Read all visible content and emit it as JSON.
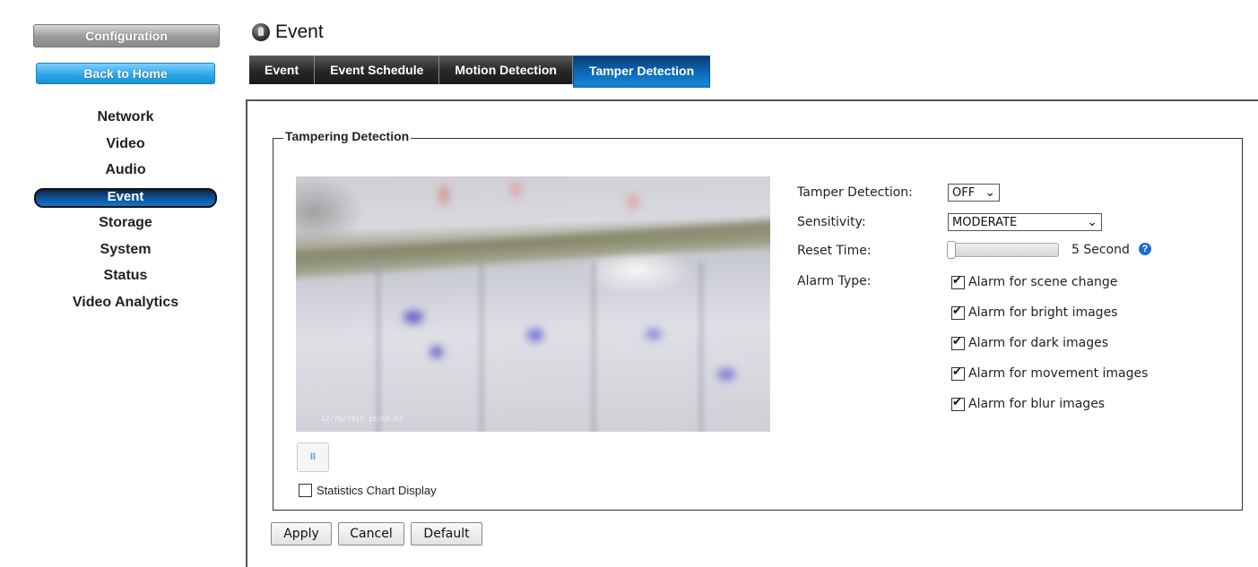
{
  "sidebar": {
    "config_label": "Configuration",
    "home_label": "Back to Home",
    "items": [
      {
        "label": "Network"
      },
      {
        "label": "Video"
      },
      {
        "label": "Audio"
      },
      {
        "label": "Event",
        "active": true
      },
      {
        "label": "Storage"
      },
      {
        "label": "System"
      },
      {
        "label": "Status"
      },
      {
        "label": "Video Analytics"
      }
    ]
  },
  "header": {
    "title": "Event",
    "icon": "event-icon"
  },
  "tabs": [
    {
      "label": "Event"
    },
    {
      "label": "Event Schedule"
    },
    {
      "label": "Motion Detection"
    },
    {
      "label": "Tamper Detection",
      "active": true
    }
  ],
  "section": {
    "legend": "Tampering Detection"
  },
  "video": {
    "timestamp": "12/25/2015  15:50:57",
    "pause_icon": "pause-icon",
    "pause_glyph": "II"
  },
  "stats": {
    "label": "Statistics Chart Display",
    "checked": false
  },
  "settings": {
    "tamper_label": "Tamper Detection:",
    "tamper_value": "OFF",
    "sensitivity_label": "Sensitivity:",
    "sensitivity_value": "MODERATE",
    "reset_label": "Reset Time:",
    "reset_value": "5 Second",
    "reset_slider_fraction": 0.0,
    "alarm_label": "Alarm Type:",
    "alarms": [
      {
        "label": "Alarm for scene change",
        "checked": true
      },
      {
        "label": "Alarm for bright images",
        "checked": true
      },
      {
        "label": "Alarm for dark images",
        "checked": true
      },
      {
        "label": "Alarm for movement images",
        "checked": true
      },
      {
        "label": "Alarm for blur images",
        "checked": true
      }
    ]
  },
  "buttons": {
    "apply": "Apply",
    "cancel": "Cancel",
    "default": "Default"
  },
  "colors": {
    "accent_blue": "#0a67b9",
    "home_button": "#2ea7ea",
    "tab_dark": "#2a2a2a"
  }
}
